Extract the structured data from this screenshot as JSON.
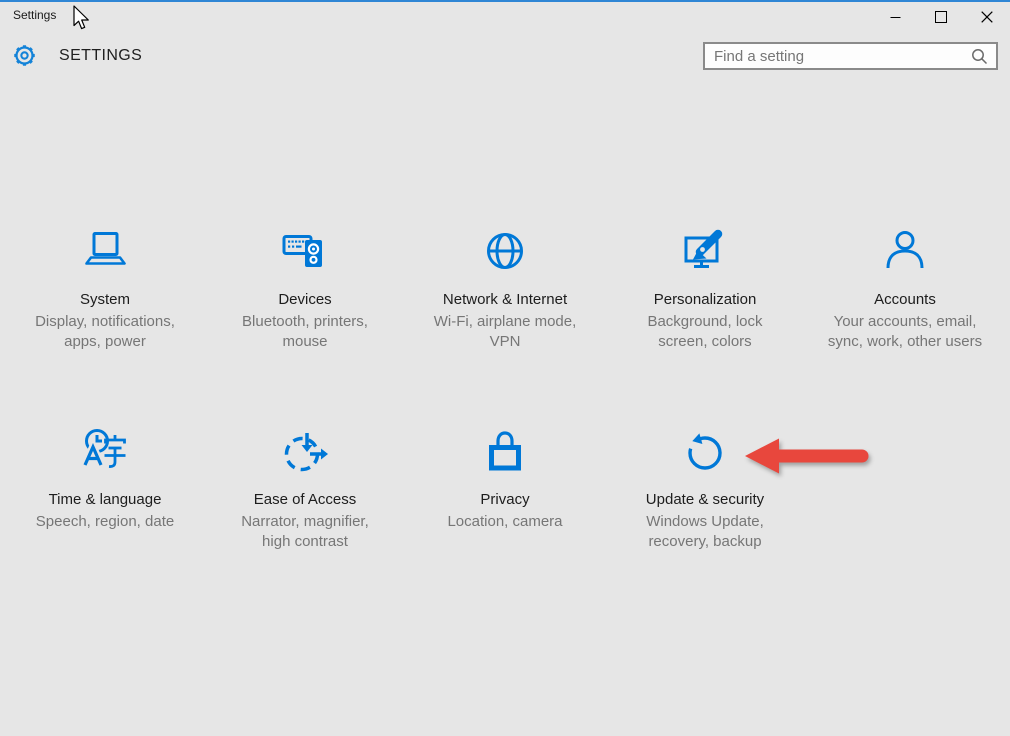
{
  "window": {
    "title": "Settings"
  },
  "header": {
    "title": "SETTINGS",
    "search_placeholder": "Find a setting"
  },
  "grid": {
    "tiles": [
      {
        "icon": "laptop-icon",
        "title": "System",
        "description": "Display, notifications,\napps, power"
      },
      {
        "icon": "keyboard-speaker-icon",
        "title": "Devices",
        "description": "Bluetooth, printers,\nmouse"
      },
      {
        "icon": "globe-icon",
        "title": "Network & Internet",
        "description": "Wi-Fi, airplane mode,\nVPN"
      },
      {
        "icon": "monitor-pen-icon",
        "title": "Personalization",
        "description": "Background, lock\nscreen, colors"
      },
      {
        "icon": "person-icon",
        "title": "Accounts",
        "description": "Your accounts, email,\nsync, work, other users"
      },
      {
        "icon": "clock-language-icon",
        "title": "Time & language",
        "description": "Speech, region, date"
      },
      {
        "icon": "dashed-clock-arrows-icon",
        "title": "Ease of Access",
        "description": "Narrator, magnifier,\nhigh contrast"
      },
      {
        "icon": "lock-icon",
        "title": "Privacy",
        "description": "Location, camera"
      },
      {
        "icon": "refresh-icon",
        "title": "Update & security",
        "description": "Windows Update,\nrecovery, backup"
      }
    ]
  },
  "annotation": {
    "shape": "left-pointing-arrow",
    "points_at": "Update & security",
    "color": "#e8473d"
  },
  "colors": {
    "accent_blue": "#0078d7",
    "background": "#e6e6e6",
    "title_text": "#1d1d1d",
    "description_text": "#767676"
  }
}
